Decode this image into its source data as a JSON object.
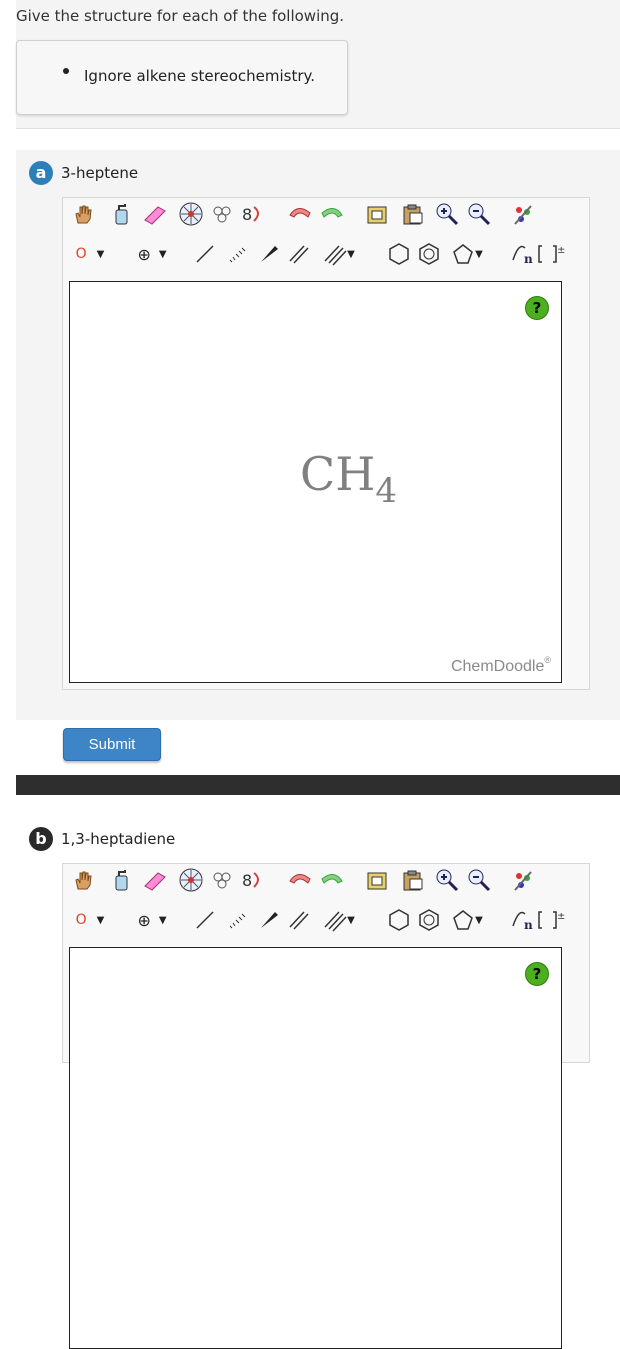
{
  "instruction": "Give the structure for each of the following.",
  "note": {
    "bullet_text": "Ignore alkene stereochemistry."
  },
  "parts": [
    {
      "badge": "a",
      "title": "3-heptene",
      "canvas_text": {
        "main": "CH",
        "sub": "4"
      },
      "submit_label": "Submit"
    },
    {
      "badge": "b",
      "title": "1,3-heptadiene"
    }
  ],
  "editor": {
    "help_label": "?",
    "brand": "ChemDoodle",
    "brand_mark": "®",
    "atom_label": "O",
    "charge_label": "⊕",
    "tools_row1": [
      "hand-tool",
      "clear-tool",
      "eraser-tool",
      "center-tool",
      "flip-tool",
      "rotate-tool",
      "undo-tool",
      "redo-tool",
      "copy-tool",
      "paste-tool",
      "zoom-in-tool",
      "zoom-out-tool",
      "clean-tool"
    ],
    "tools_row2": [
      "atom-select",
      "charge-select",
      "single-bond-tool",
      "hashed-bond-tool",
      "wedge-bond-tool",
      "double-bond-tool",
      "triple-bond-tool",
      "ring-3-tool",
      "benzene-tool",
      "ring-5-tool",
      "repeat-unit-tool",
      "bracket-tool"
    ]
  },
  "colors": {
    "badge_a": "#2c7fb8",
    "badge_b": "#2a2a2a",
    "submit": "#3d85c6",
    "help": "#4caf1f"
  }
}
